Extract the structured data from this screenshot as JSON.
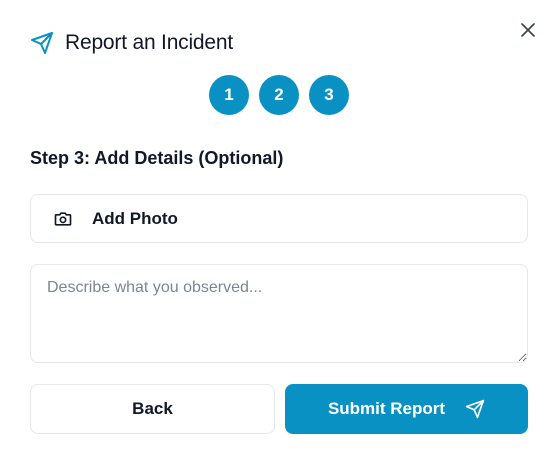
{
  "dialog": {
    "title": "Report an Incident",
    "title_icon": "send-icon",
    "close_icon": "close-icon"
  },
  "steps": [
    {
      "label": "1"
    },
    {
      "label": "2"
    },
    {
      "label": "3"
    }
  ],
  "step_heading": "Step 3: Add Details (Optional)",
  "photo": {
    "icon": "camera-icon",
    "label": "Add Photo"
  },
  "description": {
    "placeholder": "Describe what you observed...",
    "value": ""
  },
  "actions": {
    "back_label": "Back",
    "submit_label": "Submit Report",
    "submit_icon": "send-icon"
  },
  "colors": {
    "accent": "#0a91c4",
    "text": "#111827",
    "border": "#e5e7eb"
  }
}
